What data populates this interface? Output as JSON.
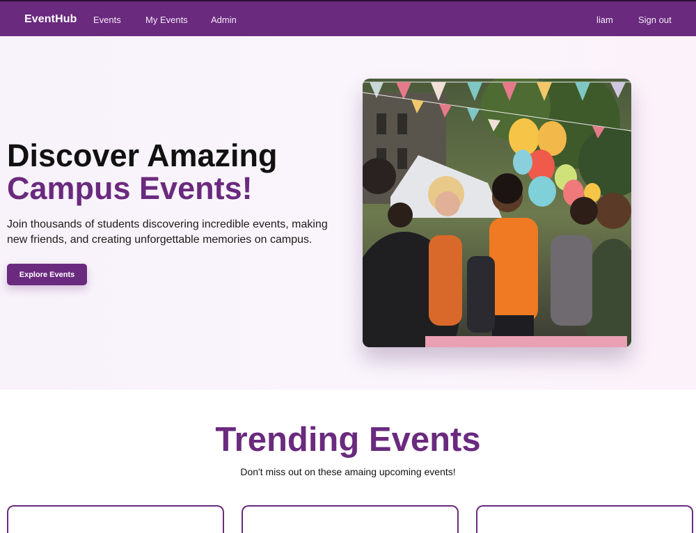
{
  "nav": {
    "brand": "EventHub",
    "links": [
      "Events",
      "My Events",
      "Admin"
    ],
    "user": "liam",
    "signout": "Sign out"
  },
  "hero": {
    "title_line1": "Discover Amazing",
    "title_line2": "Campus Events!",
    "description": "Join thousands of students discovering incredible events, making new friends, and creating unforgettable memories on campus.",
    "cta_label": "Explore Events",
    "image_icon": "campus-event-photo"
  },
  "trending": {
    "title": "Trending Events",
    "subtitle": "Don't miss out on these amaing upcoming events!"
  },
  "colors": {
    "brand": "#6a2a7e",
    "accent": "#6a2a7e"
  }
}
